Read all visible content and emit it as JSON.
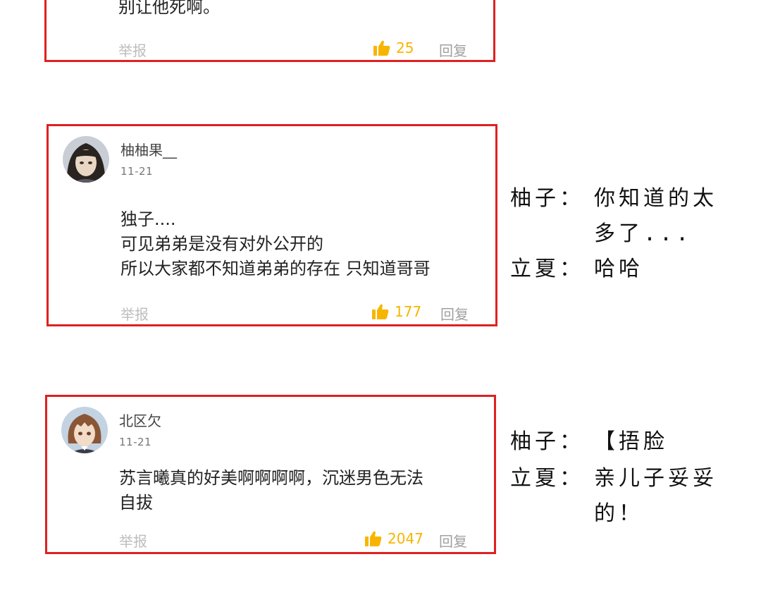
{
  "comments": [
    {
      "content": [
        "别让他死啊。"
      ],
      "report_label": "举报",
      "likes": "25",
      "reply_label": "回复"
    },
    {
      "username": "柚柚果__",
      "date": "11-21",
      "content": [
        "独子....",
        "可见弟弟是没有对外公开的",
        "所以大家都不知道弟弟的存在 只知道哥哥"
      ],
      "report_label": "举报",
      "likes": "177",
      "reply_label": "回复"
    },
    {
      "username": "北区欠",
      "date": "11-21",
      "content": [
        "苏言曦真的好美啊啊啊啊，沉迷男色无法",
        "自拔"
      ],
      "report_label": "举报",
      "likes": "2047",
      "reply_label": "回复"
    }
  ],
  "annotations": {
    "block1": {
      "line1_speaker": "柚子：",
      "line1_text": "你知道的太",
      "line1_cont": "多了...",
      "line2_speaker": "立夏：",
      "line2_text": "哈哈"
    },
    "block2": {
      "line1_speaker": "柚子：",
      "line1_text": "【捂脸",
      "line2_speaker": "立夏：",
      "line2_text": "亲儿子妥妥",
      "line2_cont": "的！"
    }
  },
  "colors": {
    "card_border": "#e02020",
    "like_color": "#f7b500"
  }
}
